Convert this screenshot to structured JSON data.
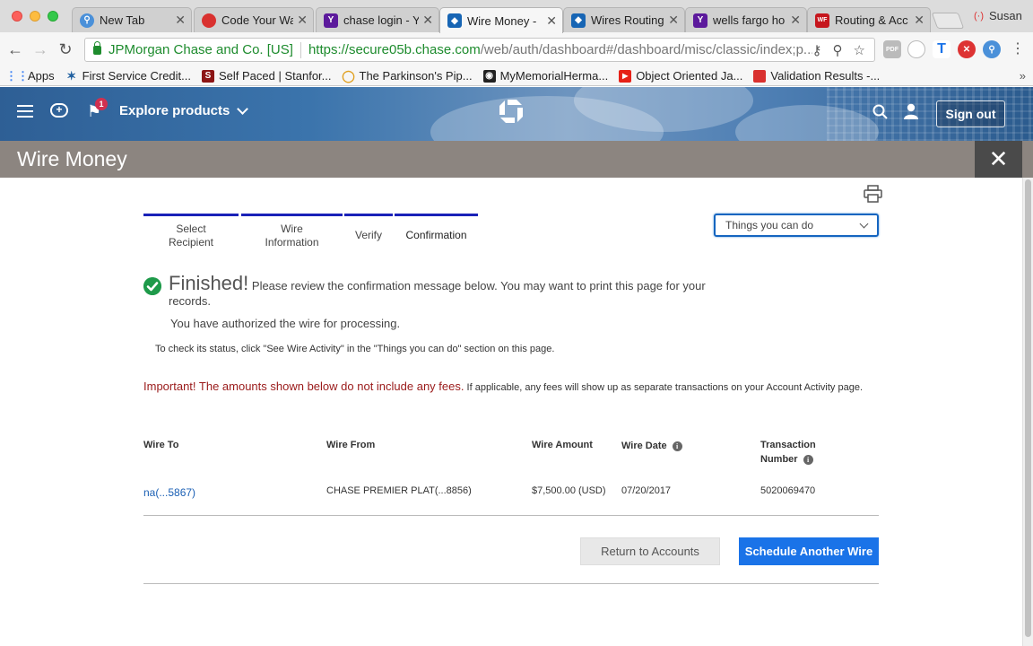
{
  "browser": {
    "tabs": [
      {
        "title": "New Tab",
        "favicon_color": "#4a90d9",
        "favicon_glyph": "⚲"
      },
      {
        "title": "Code Your Wa",
        "favicon_color": "#d9312f",
        "favicon_glyph": "◢"
      },
      {
        "title": "chase login - Y",
        "favicon_color": "#5c1a9c",
        "favicon_glyph": "Y"
      },
      {
        "title": "Wire Money - ",
        "favicon_color": "#1765b4",
        "favicon_glyph": "◆"
      },
      {
        "title": "Wires Routing",
        "favicon_color": "#1765b4",
        "favicon_glyph": "◆"
      },
      {
        "title": "wells fargo ho",
        "favicon_color": "#5c1a9c",
        "favicon_glyph": "Y"
      },
      {
        "title": "Routing & Acc",
        "favicon_color": "#c6161d",
        "favicon_glyph": "WF"
      }
    ],
    "profile_name": "Susan",
    "ev_name": "JPMorgan Chase and Co. [US]",
    "url_host": "https://secure05b.chase.com",
    "url_rest": "/web/auth/dashboard#/dashboard/misc/classic/index;p...",
    "bookmarks": [
      {
        "label": "Apps",
        "color": "#4285f4",
        "glyph": "⋮"
      },
      {
        "label": "First Service Credit...",
        "color": "#2060a0",
        "glyph": "✶"
      },
      {
        "label": "Self Paced | Stanfor...",
        "color": "#8c1515",
        "glyph": "S"
      },
      {
        "label": "The Parkinson's Pip...",
        "color": "#e0a020",
        "glyph": "◯"
      },
      {
        "label": "MyMemorialHerma...",
        "color": "#222222",
        "glyph": "◉"
      },
      {
        "label": "Object Oriented Ja...",
        "color": "#e62117",
        "glyph": "▶"
      },
      {
        "label": "Validation Results -...",
        "color": "#d9312f",
        "glyph": ""
      }
    ]
  },
  "header": {
    "explore_label": "Explore products",
    "notification_count": "1",
    "signout_label": "Sign out"
  },
  "page": {
    "title": "Wire Money"
  },
  "steps": [
    {
      "label": "Select Recipient"
    },
    {
      "label": "Wire Information"
    },
    {
      "label": "Verify"
    },
    {
      "label": "Confirmation"
    }
  ],
  "things_dropdown": {
    "value": "Things you can do"
  },
  "confirmation": {
    "finished": "Finished!",
    "review": " Please review the confirmation message below. You may want to print this page for your records.",
    "authorized": "You have authorized the wire for processing.",
    "status_note": "To check its status, click \"See Wire Activity\" in the \"Things you can do\" section on this page.",
    "important_red": "Important! The amounts shown below do not include any fees.",
    "important_rest": " If applicable, any fees will show up as separate transactions on your Account Activity page."
  },
  "table": {
    "headers": {
      "wire_to": "Wire To",
      "wire_from": "Wire From",
      "amount": "Wire Amount",
      "date": "Wire Date",
      "transaction": "Transaction Number"
    },
    "row": {
      "wire_to": "na(...5867)",
      "wire_from": "CHASE PREMIER PLAT(...8856)",
      "amount": "$7,500.00 (USD)",
      "date": "07/20/2017",
      "transaction": "5020069470"
    }
  },
  "buttons": {
    "return": "Return to Accounts",
    "schedule": "Schedule Another Wire"
  },
  "colors": {
    "chase_blue": "#1a73e8",
    "step_underline": "#1a22b8",
    "success_green": "#1e9a4a",
    "warning_red": "#9a1a1a"
  }
}
